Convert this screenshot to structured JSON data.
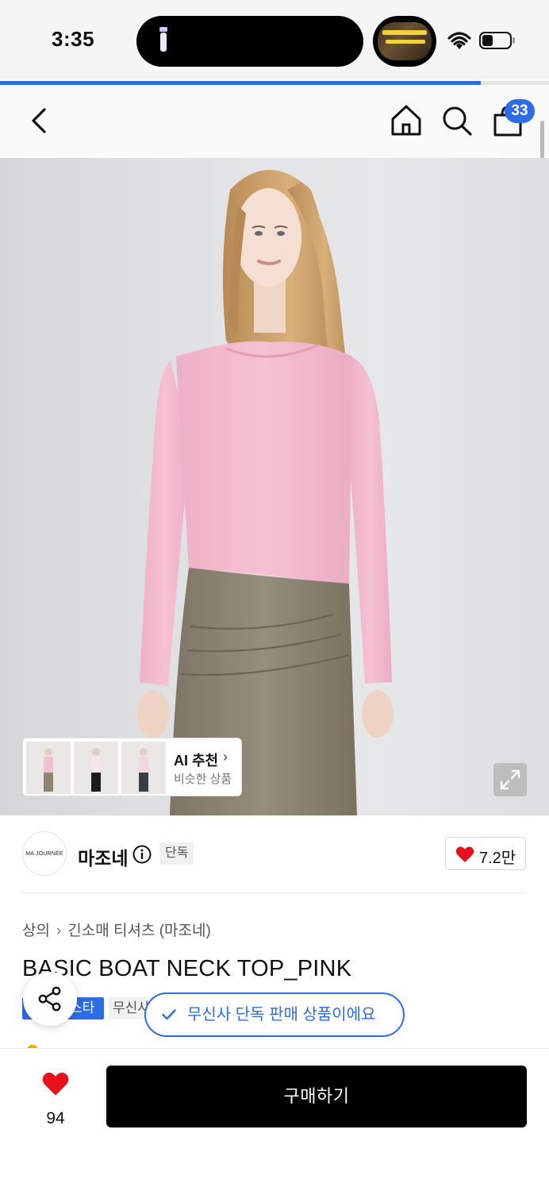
{
  "status_bar": {
    "time": "3:35",
    "battery_level": 0.4
  },
  "page_progress": 0.875,
  "header": {
    "back_icon": "chevron-left-icon",
    "home_icon": "home-icon",
    "search_icon": "search-icon",
    "cart_icon": "shopping-bag-icon",
    "cart_count": "33"
  },
  "hero": {
    "ai_recommend": {
      "title": "AI 추천",
      "subtitle": "비슷한 상품",
      "thumbnail_count": 3
    },
    "expand_icon": "expand-icon"
  },
  "brand": {
    "logo_text": "MA JOURNÉE",
    "name": "마조네",
    "tag": "단독",
    "likes": "7.2만"
  },
  "breadcrumb": [
    "상의",
    "긴소매 티셔츠 (마조네)"
  ],
  "product": {
    "title": "BASIC BOAT NECK TOP_PINK",
    "badge_blue": "스타",
    "badge_gray": "무신사"
  },
  "toast": {
    "message": "무신사 단독 판매 상품이에요"
  },
  "bottom_bar": {
    "wish_count": "94",
    "buy_label": "구매하기"
  },
  "colors": {
    "accent": "#2e6be6",
    "heart": "#e8101a",
    "buy_button": "#000000"
  }
}
